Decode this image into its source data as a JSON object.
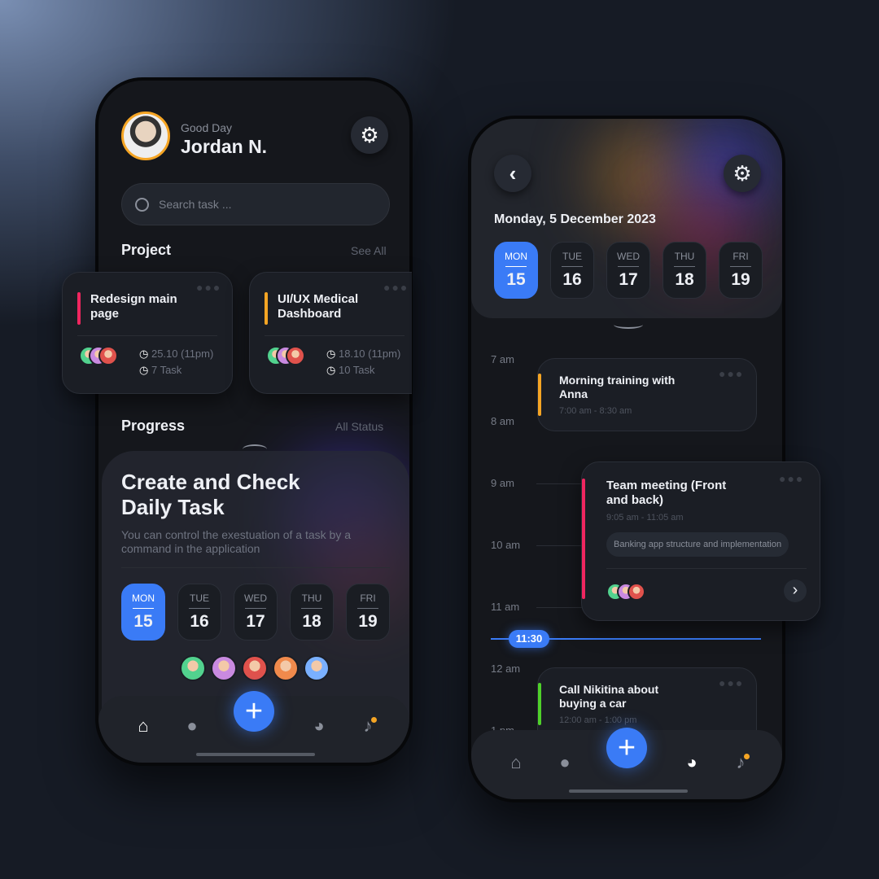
{
  "home": {
    "greeting": "Good Day",
    "user_name": "Jordan N.",
    "search_placeholder": "Search task ...",
    "project_heading": "Project",
    "see_all": "See All",
    "projects": [
      {
        "title": "Redesign main page",
        "date": "25.10 (11pm)",
        "tasks": "7 Task",
        "color": "#f0265f"
      },
      {
        "title": "UI/UX Medical Dashboard",
        "date": "18.10 (11pm)",
        "tasks": "10 Task",
        "color": "#f5a524"
      }
    ],
    "progress_heading": "Progress",
    "all_status": "All Status",
    "promo_title": "Create and Check Daily Task",
    "promo_text": "You can control the exestuation of a task by a command in the application",
    "days": [
      {
        "d": "MON",
        "n": "15"
      },
      {
        "d": "TUE",
        "n": "16"
      },
      {
        "d": "WED",
        "n": "17"
      },
      {
        "d": "THU",
        "n": "18"
      },
      {
        "d": "FRI",
        "n": "19"
      }
    ],
    "selected_day": "MON"
  },
  "calendar": {
    "date": "Monday, 5 December 2023",
    "days": [
      {
        "d": "MON",
        "n": "15"
      },
      {
        "d": "TUE",
        "n": "16"
      },
      {
        "d": "WED",
        "n": "17"
      },
      {
        "d": "THU",
        "n": "18"
      },
      {
        "d": "FRI",
        "n": "19"
      }
    ],
    "hours": [
      "7 am",
      "8 am",
      "9 am",
      "10 am",
      "11 am",
      "12 am",
      "1 pm"
    ],
    "current_time": "11:30",
    "events": [
      {
        "title": "Morning training with Anna",
        "time": "7:00 am - 8:30 am",
        "color": "#f5a524"
      },
      {
        "title": "Team meeting (Front and back)",
        "time": "9:05 am - 11:05 am",
        "tag": "Banking app structure and implementation",
        "color": "#f0265f"
      },
      {
        "title": "Call Nikitina about buying a car",
        "time": "12:00 am - 1:00 pm",
        "color": "#4fd12a"
      }
    ]
  },
  "nav": [
    "home",
    "profile",
    "add",
    "statistics",
    "notifications"
  ],
  "colors": {
    "accent": "#3a7bf6",
    "notification": "#f5a524"
  }
}
